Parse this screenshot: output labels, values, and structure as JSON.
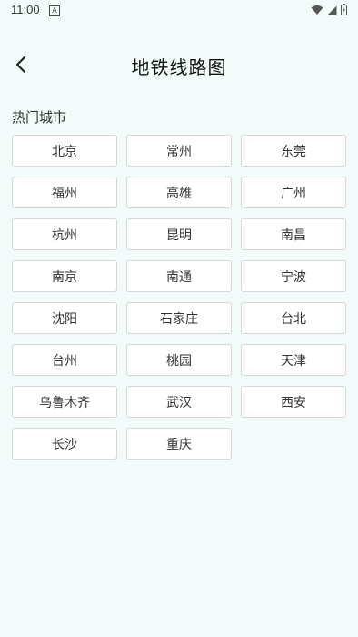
{
  "status_bar": {
    "time": "11:00",
    "app_icon_letter": "A",
    "icons": [
      "wifi-icon",
      "cellular-signal-icon",
      "battery-icon"
    ]
  },
  "header": {
    "title": "地铁线路图",
    "back_icon": "chevron-left-icon"
  },
  "section": {
    "title": "热门城市"
  },
  "cities": [
    "北京",
    "常州",
    "东莞",
    "福州",
    "高雄",
    "广州",
    "杭州",
    "昆明",
    "南昌",
    "南京",
    "南通",
    "宁波",
    "沈阳",
    "石家庄",
    "台北",
    "台州",
    "桃园",
    "天津",
    "乌鲁木齐",
    "武汉",
    "西安",
    "长沙",
    "重庆"
  ],
  "colors": {
    "background": "#f2fbfa",
    "button_background": "#ffffff",
    "button_border": "#d4d8d8",
    "text": "#333333"
  }
}
